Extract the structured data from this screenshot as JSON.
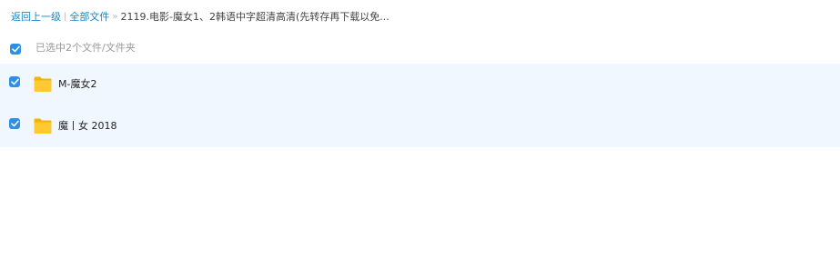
{
  "breadcrumb": {
    "back_label": "返回上一级",
    "all_files_label": "全部文件",
    "separator_1": "|",
    "separator_2": "»",
    "current_folder": "2119.电影-魔女1、2韩语中字超清高清(先转存再下载以免..."
  },
  "selection": {
    "status_text": "已选中2个文件/文件夹",
    "all_checked": true
  },
  "files": [
    {
      "name": "M-魔女2",
      "type": "folder",
      "checked": true
    },
    {
      "name": "魔丨女 2018",
      "type": "folder",
      "checked": true
    }
  ],
  "colors": {
    "link": "#1a86c5",
    "checkbox": "#2d8fe6",
    "selected_row_bg": "#f0f7fe",
    "folder_yellow": "#ffc933"
  },
  "icons": {
    "checkbox": "checkmark-icon",
    "folder": "folder-icon"
  }
}
